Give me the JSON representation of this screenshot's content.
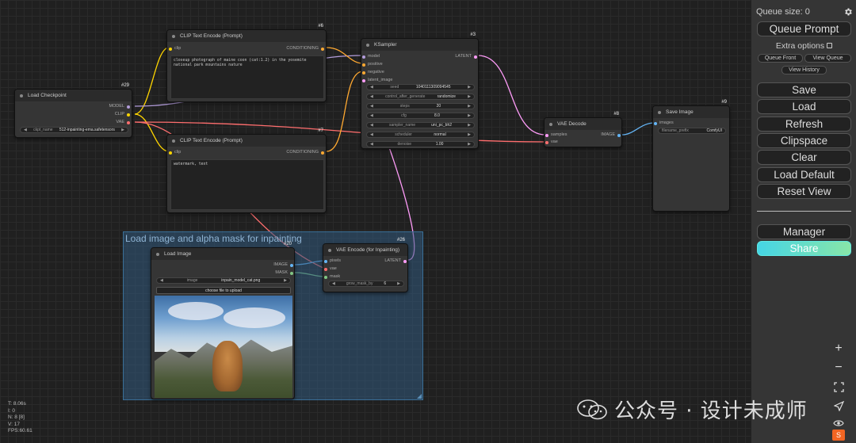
{
  "nodes": {
    "clip_top": {
      "id": "#6",
      "title": "CLIP Text Encode (Prompt)",
      "input": "clip",
      "output": "CONDITIONING",
      "text": "closeup photograph of maine coon (cat:1.2) in the yosemite national park mountains nature"
    },
    "clip_bottom": {
      "id": "#7",
      "title": "CLIP Text Encode (Prompt)",
      "input": "clip",
      "output": "CONDITIONING",
      "text": "watermark, text"
    },
    "load_checkpoint": {
      "id": "#29",
      "title": "Load Checkpoint",
      "outputs": [
        "MODEL",
        "CLIP",
        "VAE"
      ],
      "widget_label": "ckpt_name",
      "widget_value": "512-inpainting-ema.safetensors"
    },
    "ksampler": {
      "id": "#3",
      "title": "KSampler",
      "inputs": [
        "model",
        "positive",
        "negative",
        "latent_image"
      ],
      "output": "LATENT",
      "widgets": [
        {
          "label": "seed",
          "value": "1040111309094545"
        },
        {
          "label": "control_after_generate",
          "value": "randomize"
        },
        {
          "label": "steps",
          "value": "20"
        },
        {
          "label": "cfg",
          "value": "8.0"
        },
        {
          "label": "sampler_name",
          "value": "uni_pc_bh2"
        },
        {
          "label": "scheduler",
          "value": "normal"
        },
        {
          "label": "denoise",
          "value": "1.00"
        }
      ]
    },
    "vae_decode": {
      "id": "#8",
      "title": "VAE Decode",
      "inputs": [
        "samples",
        "vae"
      ],
      "output": "IMAGE"
    },
    "save_image": {
      "id": "#9",
      "title": "Save Image",
      "input": "images",
      "widget_label": "filename_prefix",
      "widget_value": "ComfyUI"
    },
    "load_image": {
      "id": "#20",
      "title": "Load Image",
      "outputs": [
        "IMAGE",
        "MASK"
      ],
      "widget_label": "image",
      "widget_value": "inpain_model_cat.png",
      "upload_label": "choose file to upload"
    },
    "vae_encode": {
      "id": "#26",
      "title": "VAE Encode (for Inpainting)",
      "inputs": [
        "pixels",
        "vae",
        "mask"
      ],
      "output": "LATENT",
      "widget_label": "grow_mask_by",
      "widget_value": "6"
    }
  },
  "group": {
    "title": "Load image and alpha mask for inpainting"
  },
  "hud": [
    "T: 8.06s",
    "I: 0",
    "N: 8 [8]",
    "V: 17",
    "FPS:60.61"
  ],
  "menu": {
    "queue_size": "Queue size: 0",
    "queue_prompt": "Queue Prompt",
    "extra_options": "Extra options",
    "queue_front": "Queue Front",
    "view_queue": "View Queue",
    "view_history": "View History",
    "save": "Save",
    "load": "Load",
    "refresh": "Refresh",
    "clipspace": "Clipspace",
    "clear": "Clear",
    "load_default": "Load Default",
    "reset_view": "Reset View",
    "manager": "Manager",
    "share": "Share"
  },
  "zoom_tools": [
    "plus-icon",
    "minus-icon",
    "fit-view-icon",
    "arrow-icon",
    "eye-icon"
  ],
  "watermark": {
    "text": "公众号 · 设计未成师"
  },
  "colors": {
    "clip_wire": "#ffd500",
    "model_wire": "#b39ddb",
    "vae_wire": "#ff6e6e",
    "cond_wire": "#ffa931",
    "latent_wire": "#ff9cf9",
    "image_wire": "#64b5f6",
    "mask_wire": "#81c784"
  }
}
